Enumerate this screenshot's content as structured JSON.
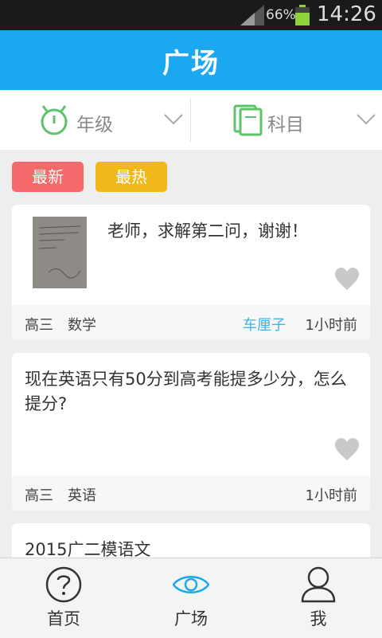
{
  "status_bar": {
    "battery": "66%",
    "time": "14:26"
  },
  "header": {
    "title": "广场"
  },
  "filters": [
    {
      "label": "年级",
      "icon": "alarm-clock-icon"
    },
    {
      "label": "科目",
      "icon": "books-icon"
    }
  ],
  "tabs": {
    "newest": "最新",
    "hottest": "最热"
  },
  "posts": [
    {
      "text": "老师，求解第二问，谢谢！",
      "has_image": true,
      "grade": "高三",
      "subject": "数学",
      "author": "车厘子",
      "time": "1小时前"
    },
    {
      "text": "现在英语只有50分到高考能提多少分，怎么提分?",
      "has_image": false,
      "grade": "高三",
      "subject": "英语",
      "author": "",
      "time": "1小时前"
    },
    {
      "text": "2015广二模语文",
      "has_image": false
    }
  ],
  "bottom_nav": {
    "home": "首页",
    "plaza": "广场",
    "me": "我"
  },
  "colors": {
    "primary": "#1aa8f0",
    "newest_tab": "#f56a6a",
    "hottest_tab": "#f0b81a",
    "author_link": "#3fb3e8",
    "grade_icon": "#5cc36b"
  }
}
